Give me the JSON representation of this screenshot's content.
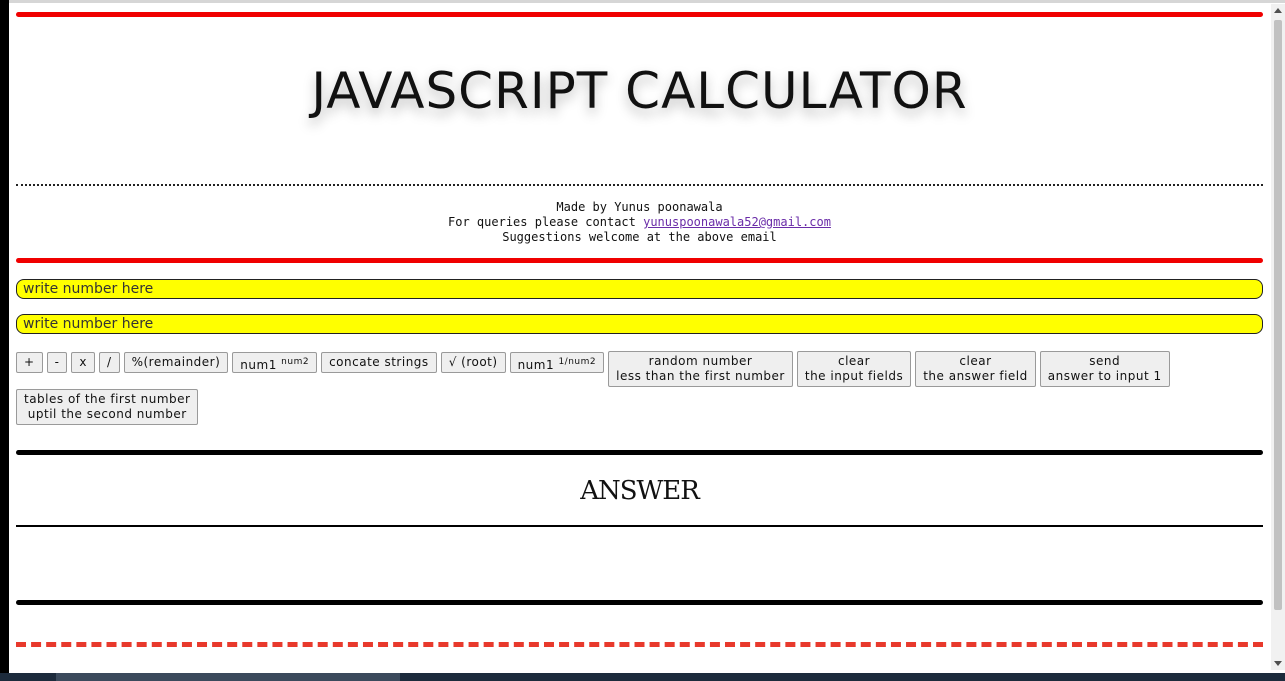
{
  "header": {
    "title": "JAVASCRIPT CALCULATOR"
  },
  "credits": {
    "line1": "Made by Yunus poonawala",
    "line2_prefix": "For queries please contact ",
    "email": "yunuspoonawala52@gmail.com",
    "line3": "Suggestions welcome at the above email"
  },
  "inputs": {
    "first": {
      "placeholder": "write number here",
      "value": ""
    },
    "second": {
      "placeholder": "write number here",
      "value": ""
    }
  },
  "buttons": {
    "add": "+",
    "subtract": "-",
    "multiply": "x",
    "divide": "/",
    "remainder": "%(remainder)",
    "power_base": "num1",
    "power_exp": "num2",
    "concat": "concate strings",
    "root": "√ (root)",
    "nth_root_base": "num1",
    "nth_root_exp": "1/num2",
    "random_l1": "random number",
    "random_l2": "less than the first number",
    "clear_inputs_l1": "clear",
    "clear_inputs_l2": "the input fields",
    "clear_answer_l1": "clear",
    "clear_answer_l2": "the answer field",
    "send_l1": "send",
    "send_l2": "answer to input 1",
    "tables_l1": "tables of the first number",
    "tables_l2": "uptil the second number"
  },
  "answer": {
    "heading": "ANSWER",
    "value": ""
  },
  "colors": {
    "accent_red": "#f00000",
    "input_yellow": "#ffff00",
    "dashed_red": "#e8392c"
  }
}
